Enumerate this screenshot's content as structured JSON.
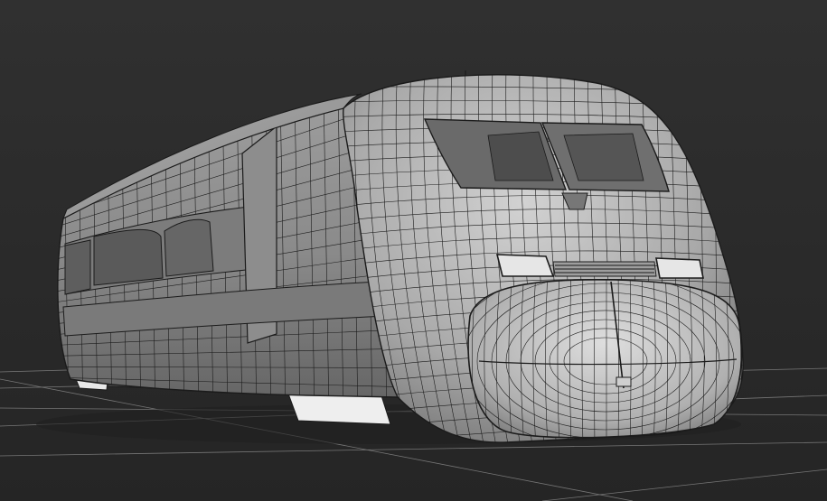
{
  "viewport": {
    "background_top": "#2f2f2f",
    "background_bottom": "#262626",
    "grid_color": "#8a8a8a",
    "wire_color": "#1b1b1b",
    "shade_dark": "#6e6e6e",
    "shade_mid": "#9a9a9a",
    "shade_light": "#c9c9c9",
    "highlight": "#eeeeee"
  },
  "scene": {
    "subject": "train-nose-wireframe-model"
  }
}
